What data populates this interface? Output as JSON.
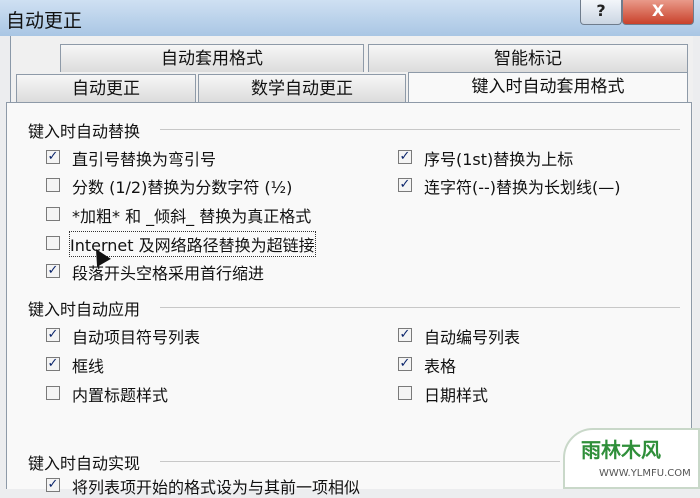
{
  "window": {
    "title": "自动更正",
    "help": "?",
    "close": "X"
  },
  "tabs_row1": [
    "自动套用格式",
    "智能标记"
  ],
  "tabs_row2": [
    "自动更正",
    "数学自动更正",
    "键入时自动套用格式"
  ],
  "section1": {
    "heading": "键入时自动替换",
    "left": [
      {
        "label": "直引号替换为弯引号",
        "checked": true
      },
      {
        "label": "分数 (1/2)替换为分数字符 (½)",
        "checked": false
      },
      {
        "label": "*加粗* 和 _倾斜_ 替换为真正格式",
        "checked": false
      },
      {
        "label": "Internet 及网络路径替换为超链接",
        "checked": false
      },
      {
        "label": "段落开头空格采用首行缩进",
        "checked": true
      }
    ],
    "right": [
      {
        "label": "序号(1st)替换为上标",
        "checked": true
      },
      {
        "label": "连字符(--)替换为长划线(—)",
        "checked": true
      }
    ]
  },
  "section2": {
    "heading": "键入时自动应用",
    "left": [
      {
        "label": "自动项目符号列表",
        "checked": true
      },
      {
        "label": "框线",
        "checked": true
      },
      {
        "label": "内置标题样式",
        "checked": false
      }
    ],
    "right": [
      {
        "label": "自动编号列表",
        "checked": true
      },
      {
        "label": "表格",
        "checked": true
      },
      {
        "label": "日期样式",
        "checked": false
      }
    ]
  },
  "section3": {
    "heading": "键入时自动实现",
    "left": [
      {
        "label": "将列表项开始的格式设为与其前一项相似",
        "checked": true
      }
    ]
  },
  "watermark": {
    "name": "雨林木风",
    "url": "WWW.YLMFU.COM"
  }
}
